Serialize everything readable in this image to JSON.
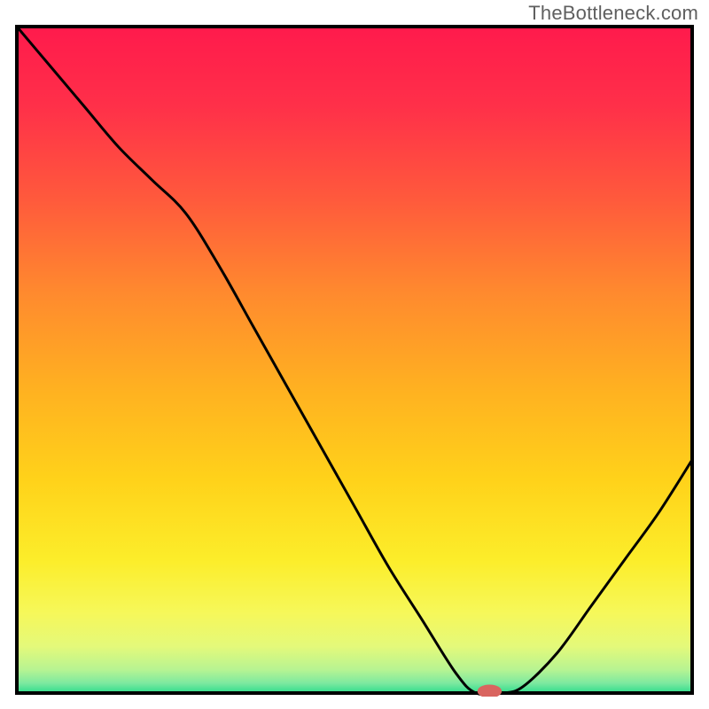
{
  "watermark": "TheBottleneck.com",
  "chart_data": {
    "type": "line",
    "title": "",
    "xlabel": "",
    "ylabel": "",
    "xlim": [
      0,
      1
    ],
    "ylim": [
      0,
      1
    ],
    "grid": false,
    "legend": false,
    "annotations": [],
    "x": [
      0.0,
      0.05,
      0.1,
      0.15,
      0.2,
      0.25,
      0.3,
      0.35,
      0.4,
      0.45,
      0.5,
      0.55,
      0.6,
      0.65,
      0.68,
      0.72,
      0.75,
      0.8,
      0.85,
      0.9,
      0.95,
      1.0
    ],
    "y": [
      1.0,
      0.94,
      0.88,
      0.82,
      0.77,
      0.72,
      0.64,
      0.55,
      0.46,
      0.37,
      0.28,
      0.19,
      0.11,
      0.03,
      0.0,
      0.0,
      0.01,
      0.06,
      0.13,
      0.2,
      0.27,
      0.35
    ],
    "marker": {
      "x": 0.7,
      "y": 0.0,
      "color": "#d9645f",
      "rx": 0.018,
      "ry": 0.01
    },
    "background_gradient": [
      {
        "t": 0.0,
        "color": "#ff1a4c"
      },
      {
        "t": 0.12,
        "color": "#ff3049"
      },
      {
        "t": 0.26,
        "color": "#ff5a3c"
      },
      {
        "t": 0.4,
        "color": "#ff8a2e"
      },
      {
        "t": 0.54,
        "color": "#ffb021"
      },
      {
        "t": 0.68,
        "color": "#ffd21a"
      },
      {
        "t": 0.8,
        "color": "#fced2a"
      },
      {
        "t": 0.88,
        "color": "#f6f85a"
      },
      {
        "t": 0.93,
        "color": "#e4f97a"
      },
      {
        "t": 0.965,
        "color": "#b7f492"
      },
      {
        "t": 0.985,
        "color": "#7de9a0"
      },
      {
        "t": 1.0,
        "color": "#2fdc8c"
      }
    ],
    "axis_color": "#000000",
    "line_color": "#000000",
    "line_width": 3
  }
}
